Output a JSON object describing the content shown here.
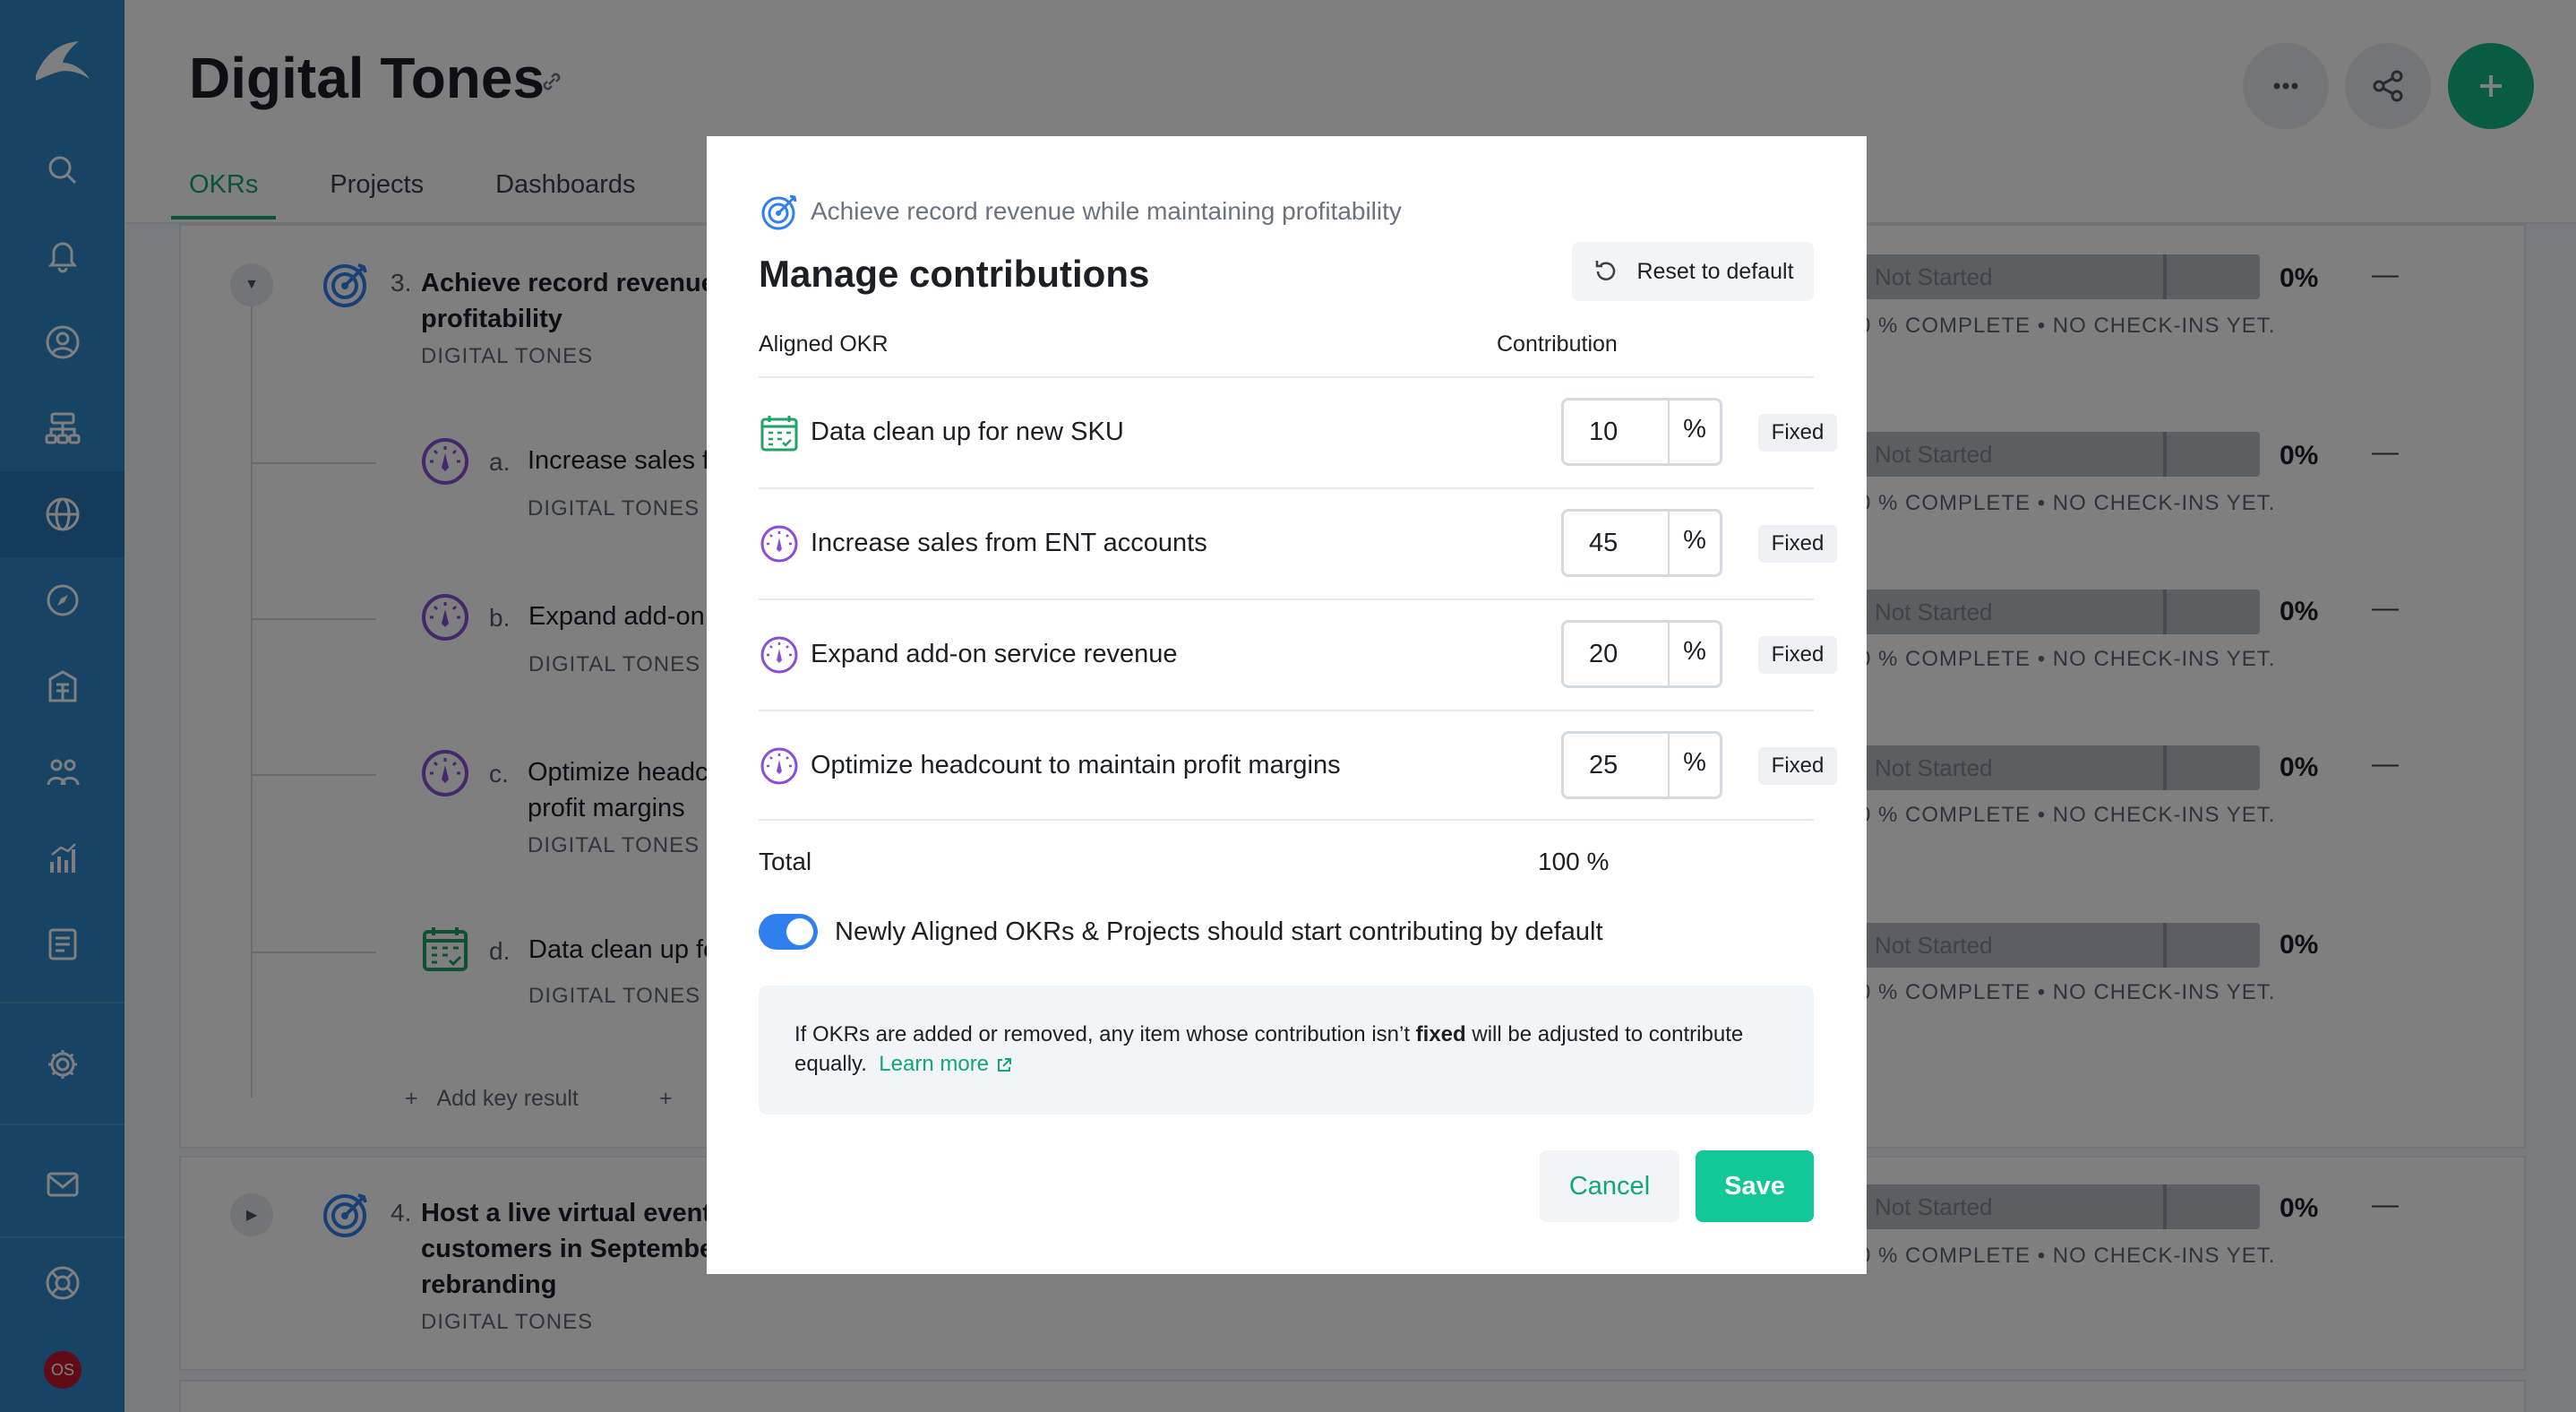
{
  "page": {
    "title": "Digital Tones",
    "tabs": [
      {
        "label": "OKRs",
        "active": true
      },
      {
        "label": "Projects",
        "active": false
      },
      {
        "label": "Dashboards",
        "active": false
      }
    ]
  },
  "sidebar": {
    "items": [
      "search-icon",
      "bell-icon",
      "user-circle-icon",
      "hierarchy-icon",
      "globe-icon",
      "compass-icon",
      "building-icon",
      "people-icon",
      "chart-icon",
      "document-icon",
      "gear-icon",
      "mail-icon",
      "lifebuoy-icon"
    ],
    "avatar": "OS"
  },
  "okrs": [
    {
      "num": "3.",
      "name_l1": "Achieve record revenue",
      "name_l2": "profitability",
      "owner": "DIGITAL TONES",
      "status": "Not Started",
      "pct": "0%",
      "dash": "—",
      "meta": "0 % COMPLETE • NO CHECK-INS YET."
    },
    {
      "num": "a.",
      "name_l1": "Increase sales f",
      "owner": "DIGITAL TONES",
      "status": "Not Started",
      "pct": "0%",
      "dash": "—",
      "meta": "0 % COMPLETE • NO CHECK-INS YET."
    },
    {
      "num": "b.",
      "name_l1": "Expand add-on",
      "owner": "DIGITAL TONES",
      "status": "Not Started",
      "pct": "0%",
      "dash": "—",
      "meta": "0 % COMPLETE • NO CHECK-INS YET."
    },
    {
      "num": "c.",
      "name_l1": "Optimize headc",
      "name_l2": "profit margins",
      "owner": "DIGITAL TONES",
      "status": "Not Started",
      "pct": "0%",
      "dash": "—",
      "meta": "0 % COMPLETE • NO CHECK-INS YET."
    },
    {
      "num": "d.",
      "name_l1": "Data clean up fo",
      "owner": "DIGITAL TONES",
      "status": "Not Started",
      "pct": "0%",
      "dash": "—",
      "meta": "0 % COMPLETE • NO CHECK-INS YET."
    },
    {
      "num": "4.",
      "name_l1": "Host a live virtual event",
      "name_l2": "customers in Septembe",
      "name_l3": "rebranding",
      "owner": "DIGITAL TONES",
      "status": "Not Started",
      "pct": "0%",
      "dash": "—",
      "meta": "0 % COMPLETE • NO CHECK-INS YET."
    }
  ],
  "add_key_result": "Add key result",
  "modal": {
    "breadcrumb": "Achieve record revenue while maintaining profitability",
    "title": "Manage contributions",
    "reset_label": "Reset to default",
    "col_okr": "Aligned OKR",
    "col_contribution": "Contribution",
    "rows": [
      {
        "name": "Data clean up for new SKU",
        "value": "10",
        "unit": "%",
        "badge": "Fixed",
        "icon": "project-calendar-icon"
      },
      {
        "name": "Increase sales from ENT accounts",
        "value": "45",
        "unit": "%",
        "badge": "Fixed",
        "icon": "key-result-gauge-icon"
      },
      {
        "name": "Expand add-on service revenue",
        "value": "20",
        "unit": "%",
        "badge": "Fixed",
        "icon": "key-result-gauge-icon"
      },
      {
        "name": "Optimize headcount to maintain profit margins",
        "value": "25",
        "unit": "%",
        "badge": "Fixed",
        "icon": "key-result-gauge-icon"
      }
    ],
    "total_label": "Total",
    "total_value": "100 %",
    "toggle_label": "Newly Aligned OKRs & Projects should start contributing by default",
    "toggle_on": true,
    "info_pre": "If OKRs are added or removed, any item whose contribution isn’t ",
    "info_bold": "fixed",
    "info_post": " will be adjusted to contribute equally.",
    "learn_more": "Learn more",
    "cancel_label": "Cancel",
    "save_label": "Save"
  },
  "colors": {
    "sidebar": "#2f86c9",
    "accent_green": "#12c896",
    "toggle_blue": "#2f80ed",
    "kr_purple": "#8b4fd6"
  }
}
